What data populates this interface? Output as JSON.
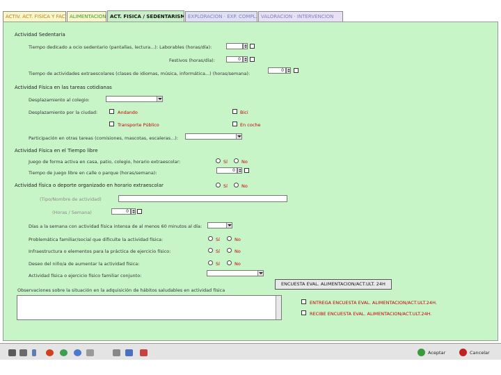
{
  "tabs": [
    {
      "label": "ACTIV. ACT. FISICA Y FACT."
    },
    {
      "label": "ALIMENTACION"
    },
    {
      "label": "ACT. FISICA / SEDENTARISMO"
    },
    {
      "label": "EXPLORACION · EXP. COMPL."
    },
    {
      "label": "VALORACION · INTERVENCION"
    }
  ],
  "sedentary": {
    "title": "Actividad Sedentaria",
    "work_time_label": "Tiempo dedicado a ocio sedentario (pantallas, lectura...): Laborables (horas/día):",
    "work_time_value": "",
    "weekend_label": "Festivos (horas/día):",
    "weekend_value": "0",
    "extra_label": "Tiempo de actividades extraescolares (clases de idiomas, música, informática...) (horas/semana):",
    "extra_value": "0"
  },
  "daily": {
    "title": "Actividad Física en las tareas cotidianas",
    "commute_school_label": "Desplazamiento al colegio:",
    "commute_city_label": "Desplazamiento por la ciudad:",
    "opt_walk": "Andando",
    "opt_bike": "Bici",
    "opt_public": "Transporte Público",
    "opt_car": "En coche",
    "chores_label": "Participación en otras tareas (comisiones, mascotas, escaleras...):"
  },
  "free": {
    "title": "Actividad Física en el Tiempo libre",
    "play_label": "Juego de forma activa en casa, patio, colegio, horario extraescolar:",
    "yes": "Sí",
    "no": "No",
    "park_label": "Tiempo de juego libre en calle o parque (horas/semana):",
    "park_value": "0"
  },
  "organized": {
    "title": "Actividad física o deporte organizado en horario extraescolar",
    "yes": "Sí",
    "no": "No",
    "type_label": "(Tipo/Nombre de actividad)",
    "hours_label": "(Horas / Semana)",
    "hours_value": "0",
    "days_label": "Días a la semana con actividad física intensa de al menos 60 minutos al día:",
    "family_label": "Problemática familiar/social que dificulte la actividad física:",
    "infra_label": "Infraestructura o elementos para la práctica de ejercicio físico:",
    "desire_label": "Deseo del niño/a de aumentar la actividad física:",
    "family_ex_label": "Actividad física o ejercicio físico familiar conjunto:",
    "si": "Sí",
    "no_short": "No"
  },
  "survey_button": "ENCUESTA EVAL. ALIMENTACION/ACT.ULT. 24H",
  "observations_label": "Observaciones sobre la situación en la adquisición de hábitos saludables en actividad física",
  "side_checks": [
    "ENTREGA ENCUESTA EVAL. ALIMENTACION/ACT.ULT.24H.",
    "RECIBE ENCUESTA EVAL. ALIMENTACION/ACT.ULT.24H."
  ],
  "footer": {
    "accept": "Aceptar",
    "cancel": "Cancelar"
  },
  "colors": {
    "panel": "#c8f5c8",
    "accent_red": "#c00000"
  }
}
